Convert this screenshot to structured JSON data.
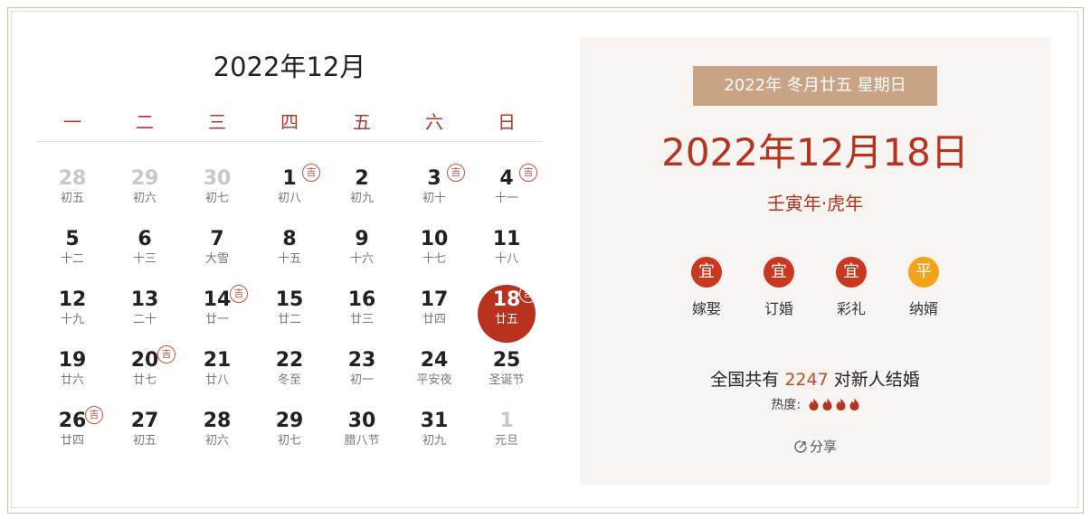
{
  "calendar": {
    "title": "2022年12月",
    "weekdays": [
      "一",
      "二",
      "三",
      "四",
      "五",
      "六",
      "日"
    ],
    "days": [
      {
        "d": "28",
        "l": "初五",
        "other": true
      },
      {
        "d": "29",
        "l": "初六",
        "other": true
      },
      {
        "d": "30",
        "l": "初七",
        "other": true
      },
      {
        "d": "1",
        "l": "初八",
        "ji": true
      },
      {
        "d": "2",
        "l": "初九"
      },
      {
        "d": "3",
        "l": "初十",
        "ji": true
      },
      {
        "d": "4",
        "l": "十一",
        "ji": true
      },
      {
        "d": "5",
        "l": "十二"
      },
      {
        "d": "6",
        "l": "十三"
      },
      {
        "d": "7",
        "l": "大雪"
      },
      {
        "d": "8",
        "l": "十五"
      },
      {
        "d": "9",
        "l": "十六"
      },
      {
        "d": "10",
        "l": "十七"
      },
      {
        "d": "11",
        "l": "十八"
      },
      {
        "d": "12",
        "l": "十九"
      },
      {
        "d": "13",
        "l": "二十"
      },
      {
        "d": "14",
        "l": "廿一",
        "ji": true
      },
      {
        "d": "15",
        "l": "廿二"
      },
      {
        "d": "16",
        "l": "廿三"
      },
      {
        "d": "17",
        "l": "廿四"
      },
      {
        "d": "18",
        "l": "廿五",
        "ji": true,
        "selected": true
      },
      {
        "d": "19",
        "l": "廿六"
      },
      {
        "d": "20",
        "l": "廿七",
        "ji": true
      },
      {
        "d": "21",
        "l": "廿八"
      },
      {
        "d": "22",
        "l": "冬至"
      },
      {
        "d": "23",
        "l": "初一"
      },
      {
        "d": "24",
        "l": "平安夜"
      },
      {
        "d": "25",
        "l": "圣诞节"
      },
      {
        "d": "26",
        "l": "廿四",
        "ji": true
      },
      {
        "d": "27",
        "l": "初五"
      },
      {
        "d": "28",
        "l": "初六"
      },
      {
        "d": "29",
        "l": "初七"
      },
      {
        "d": "30",
        "l": "腊八节"
      },
      {
        "d": "31",
        "l": "初九"
      },
      {
        "d": "1",
        "l": "元旦",
        "other": true
      }
    ],
    "ji_label": "吉"
  },
  "detail": {
    "lunar_banner": "2022年 冬月廿五 星期日",
    "date": "2022年12月18日",
    "ganzhi": "壬寅年·虎年",
    "activities": [
      {
        "badge": "宜",
        "label": "嫁娶",
        "kind": "yi"
      },
      {
        "badge": "宜",
        "label": "订婚",
        "kind": "yi"
      },
      {
        "badge": "宜",
        "label": "彩礼",
        "kind": "yi"
      },
      {
        "badge": "平",
        "label": "纳婿",
        "kind": "ping"
      }
    ],
    "stat_prefix": "全国共有",
    "stat_count": "2247",
    "stat_suffix": "对新人结婚",
    "heat_label": "热度:",
    "heat_level": 4,
    "share_label": "分享"
  },
  "colors": {
    "accent": "#b8321f",
    "banner": "#c8a384",
    "ping": "#f2a31a",
    "panel_bg": "#f8f4f1"
  }
}
